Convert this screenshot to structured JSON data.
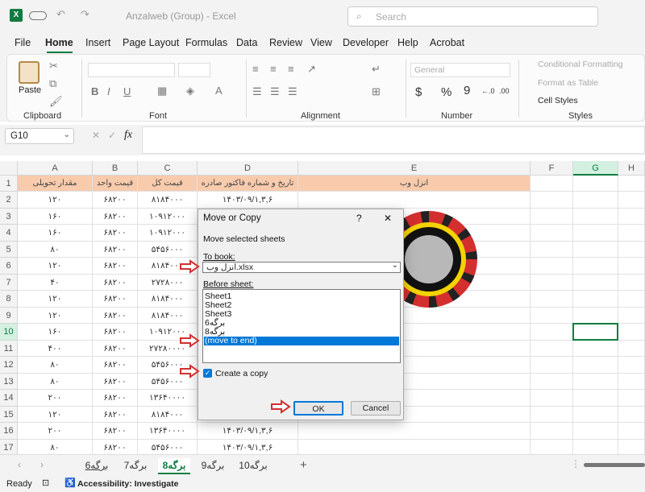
{
  "titlebar": {
    "title": "Anzalweb (Group) - Excel",
    "search_placeholder": "Search"
  },
  "menu": [
    "File",
    "Home",
    "Insert",
    "Page Layout",
    "Formulas",
    "Data",
    "Review",
    "View",
    "Developer",
    "Help",
    "Acrobat"
  ],
  "ribbon": {
    "clipboard": {
      "paste": "Paste",
      "label": "Clipboard"
    },
    "font": {
      "label": "Font"
    },
    "alignment": {
      "label": "Alignment"
    },
    "number": {
      "format": "General",
      "label": "Number"
    },
    "styles": {
      "cond": "Conditional Formatting",
      "table": "Format as Table",
      "cell": "Cell Styles",
      "label": "Styles"
    }
  },
  "formula_bar": {
    "name_box": "G10",
    "fx": "fx",
    "value": ""
  },
  "columns": [
    "A",
    "B",
    "C",
    "D",
    "E",
    "F",
    "G",
    "H"
  ],
  "headers": {
    "A": "مقدار تحویلی",
    "B": "قیمت واحد",
    "C": "قیمت کل",
    "D": "تاریخ و شماره فاکتور صادره",
    "E": "انزل وب"
  },
  "rows": [
    {
      "n": "2",
      "a": "۱۲۰",
      "b": "۶۸۲۰۰",
      "c": "۸۱۸۴۰۰۰",
      "d": "۱۴۰۳/۰۹/۱,۳,۶"
    },
    {
      "n": "3",
      "a": "۱۶۰",
      "b": "۶۸۲۰۰",
      "c": "۱۰۹۱۲۰۰۰",
      "d": ""
    },
    {
      "n": "4",
      "a": "۱۶۰",
      "b": "۶۸۲۰۰",
      "c": "۱۰۹۱۲۰۰۰",
      "d": ""
    },
    {
      "n": "5",
      "a": "۸۰",
      "b": "۶۸۲۰۰",
      "c": "۵۴۵۶۰۰۰",
      "d": ""
    },
    {
      "n": "6",
      "a": "۱۲۰",
      "b": "۶۸۲۰۰",
      "c": "۸۱۸۴۰۰۰",
      "d": ""
    },
    {
      "n": "7",
      "a": "۴۰",
      "b": "۶۸۲۰۰",
      "c": "۲۷۲۸۰۰۰",
      "d": ""
    },
    {
      "n": "8",
      "a": "۱۲۰",
      "b": "۶۸۲۰۰",
      "c": "۸۱۸۴۰۰۰",
      "d": ""
    },
    {
      "n": "9",
      "a": "۱۲۰",
      "b": "۶۸۲۰۰",
      "c": "۸۱۸۴۰۰۰",
      "d": ""
    },
    {
      "n": "10",
      "a": "۱۶۰",
      "b": "۶۸۲۰۰",
      "c": "۱۰۹۱۲۰۰۰",
      "d": ""
    },
    {
      "n": "11",
      "a": "۴۰۰",
      "b": "۶۸۲۰۰",
      "c": "۲۷۲۸۰۰۰۰",
      "d": ""
    },
    {
      "n": "12",
      "a": "۸۰",
      "b": "۶۸۲۰۰",
      "c": "۵۴۵۶۰۰۰",
      "d": ""
    },
    {
      "n": "13",
      "a": "۸۰",
      "b": "۶۸۲۰۰",
      "c": "۵۴۵۶۰۰۰",
      "d": ""
    },
    {
      "n": "14",
      "a": "۲۰۰",
      "b": "۶۸۲۰۰",
      "c": "۱۳۶۴۰۰۰۰",
      "d": ""
    },
    {
      "n": "15",
      "a": "۱۲۰",
      "b": "۶۸۲۰۰",
      "c": "۸۱۸۴۰۰۰",
      "d": ""
    },
    {
      "n": "16",
      "a": "۲۰۰",
      "b": "۶۸۲۰۰",
      "c": "۱۳۶۴۰۰۰۰",
      "d": "۱۴۰۳/۰۹/۱,۳,۶"
    },
    {
      "n": "17",
      "a": "۸۰",
      "b": "۶۸۲۰۰",
      "c": "۵۴۵۶۰۰۰",
      "d": "۱۴۰۳/۰۹/۱,۳,۶"
    }
  ],
  "dialog": {
    "title": "Move or Copy",
    "help": "?",
    "close": "✕",
    "subtitle": "Move selected sheets",
    "to_book_label": "To book:",
    "to_book_value": "انزل وب.xlsx",
    "before_label": "Before sheet:",
    "before_items": [
      "Sheet1",
      "Sheet2",
      "Sheet3",
      "برگه6",
      "برگه8",
      "(move to end)"
    ],
    "selected_index": 5,
    "copy_label": "Create a copy",
    "ok": "OK",
    "cancel": "Cancel"
  },
  "sheets": [
    "برگه6",
    "برگه7",
    "برگه8",
    "برگه9",
    "برگه10"
  ],
  "active_sheet": 2,
  "status": {
    "ready": "Ready",
    "accessibility": "Accessibility: Investigate"
  },
  "colors": {
    "header_fill": "#f8cbad",
    "excel_green": "#107c41",
    "selection_blue": "#0078d7"
  }
}
